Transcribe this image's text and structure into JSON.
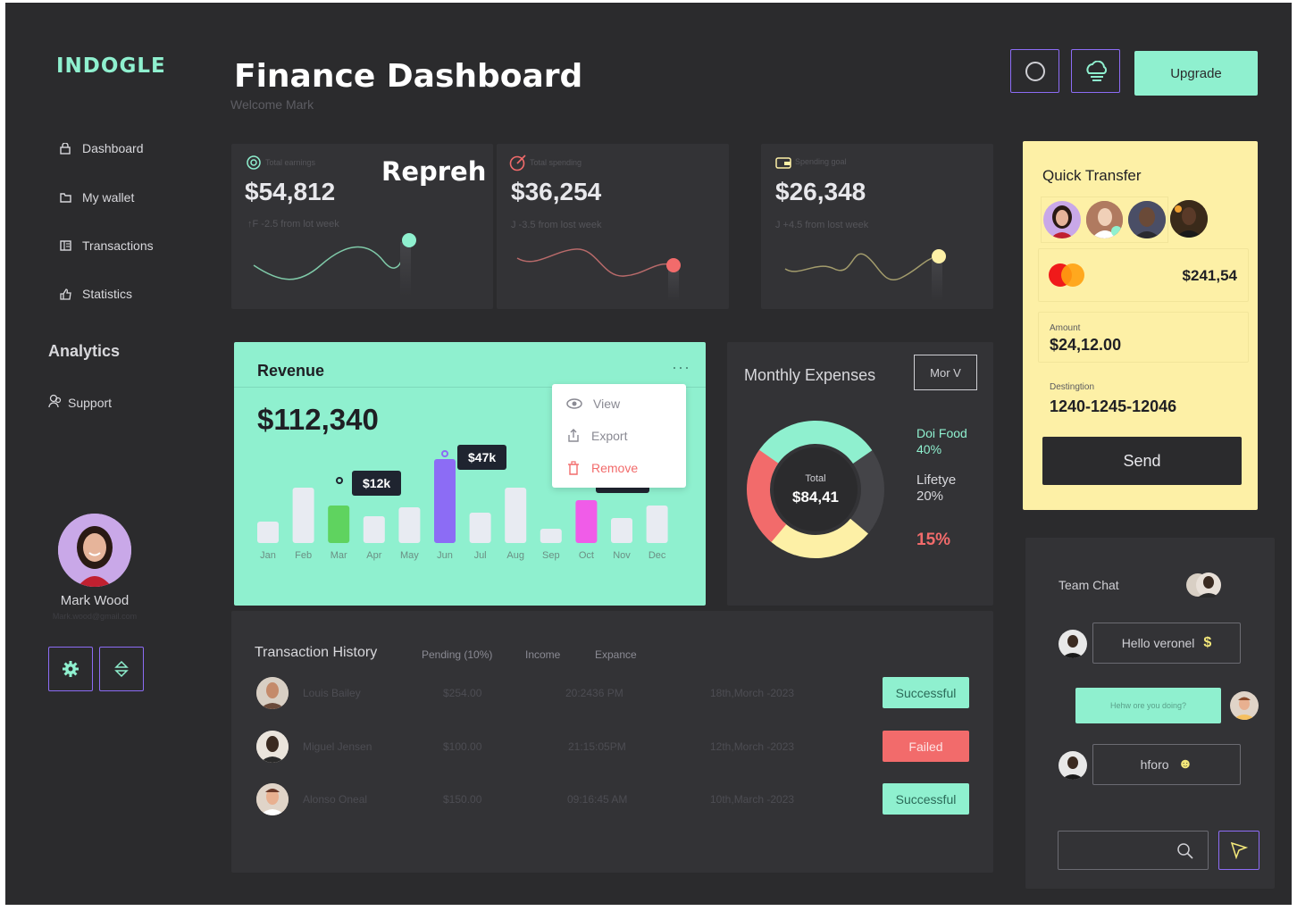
{
  "app": {
    "logo": "INDOGLE"
  },
  "header": {
    "title": "Finance Dashboard",
    "subtitle": "Welcome Mark",
    "upgrade_label": "Upgrade"
  },
  "sidebar": {
    "items": [
      {
        "label": "Dashboard",
        "icon": "lock-icon"
      },
      {
        "label": "My wallet",
        "icon": "folder-icon"
      },
      {
        "label": "Transactions",
        "icon": "ledger-icon"
      },
      {
        "label": "Statistics",
        "icon": "thumbs-up-icon"
      }
    ],
    "section_title": "Analytics",
    "support_label": "Support"
  },
  "profile": {
    "name": "Mark Wood",
    "email": "Mark.wood@gmail.com"
  },
  "cards": [
    {
      "label": "Total earnings",
      "value": "$54,812",
      "sub": "↑F -2.5 from lot week",
      "overlay": "Repreh",
      "accent": "#8ff0cf"
    },
    {
      "label": "Total spending",
      "value": "$36,254",
      "sub": "J -3.5 from lost week",
      "accent": "#f26b6b"
    },
    {
      "label": "Spending goal",
      "value": "$26,348",
      "sub": "J +4.5 from lost week",
      "accent": "#fdf0a6"
    }
  ],
  "revenue": {
    "title": "Revenue",
    "value": "$112,340",
    "tooltips": [
      "$12k",
      "$47k"
    ],
    "menu": [
      "View",
      "Export",
      "Remove"
    ]
  },
  "chart_data": {
    "type": "bar",
    "categories": [
      "Jan",
      "Feb",
      "Mar",
      "Apr",
      "May",
      "Jun",
      "Jul",
      "Aug",
      "Sep",
      "Oct",
      "Nov",
      "Dec"
    ],
    "values": [
      12,
      31,
      21,
      15,
      20,
      47,
      17,
      31,
      8,
      24,
      14,
      21
    ],
    "highlighted": {
      "Mar": "#5fd35f",
      "Jun": "#8c6cf5",
      "Oct": "#f05ce8"
    },
    "labels": {
      "Mar": "$12k",
      "Jun": "$47k"
    },
    "ylim": [
      0,
      55
    ]
  },
  "expenses": {
    "title": "Monthly Expenses",
    "filter_label": "Mor V",
    "total_label": "Total",
    "total_value": "$84,41",
    "legend": [
      {
        "name": "Doi Food",
        "pct": "40%",
        "color": "#8ff0cf"
      },
      {
        "name": "Lifetye",
        "pct": "20%",
        "color": "#d8d8dc"
      },
      {
        "name": "",
        "pct": "15%",
        "color": "#f26b6b"
      }
    ]
  },
  "quick_transfer": {
    "title": "Quick Transfer",
    "card_amount": "$241,54",
    "amount_label": "Amount",
    "amount_value": "$24,12.00",
    "destination_label": "Destingtion",
    "destination_value": "1240-1245-12046",
    "send_label": "Send"
  },
  "transactions": {
    "title": "Transaction History",
    "tabs": [
      "Pending (10%)",
      "Income",
      "Expance"
    ],
    "rows": [
      {
        "name": "Louis Bailey",
        "amount": "$254.00",
        "time": "20:2436 PM",
        "date": "18th,Morch -2023",
        "status": "Successful"
      },
      {
        "name": "Miguel Jensen",
        "amount": "$100.00",
        "time": "21:15:05PM",
        "date": "12th,Morch -2023",
        "status": "Failed"
      },
      {
        "name": "Alonso Oneal",
        "amount": "$150.00",
        "time": "09:16:45 AM",
        "date": "10th,March -2023",
        "status": "Successful"
      }
    ]
  },
  "chat": {
    "title": "Team Chat",
    "messages": [
      "Hello veronel",
      "Hehw ore you doing?",
      "hforo"
    ],
    "message_icons": [
      "$",
      "☻"
    ]
  }
}
